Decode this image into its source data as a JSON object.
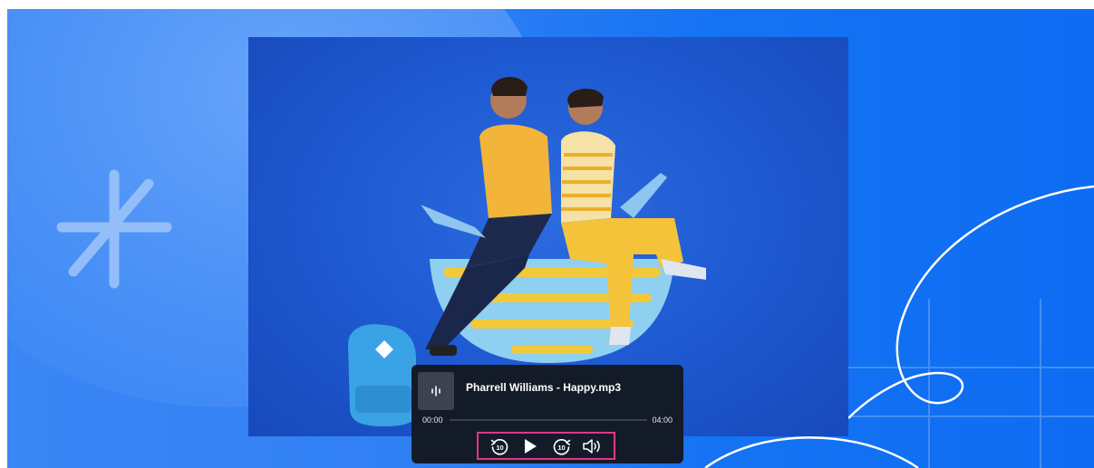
{
  "player": {
    "track_title": "Pharrell Williams - Happy.mp3",
    "current_time": "00:00",
    "duration": "04:00",
    "progress_fraction": 0.0,
    "skip_seconds": "10",
    "icons": {
      "thumbnail": "audio-waveform-icon",
      "rewind": "rewind-10-icon",
      "play": "play-icon",
      "forward": "forward-10-icon",
      "volume": "volume-icon"
    }
  },
  "colors": {
    "player_bg": "#141b28",
    "highlight_border": "#e0368a",
    "background_blue": "#1573f3"
  }
}
